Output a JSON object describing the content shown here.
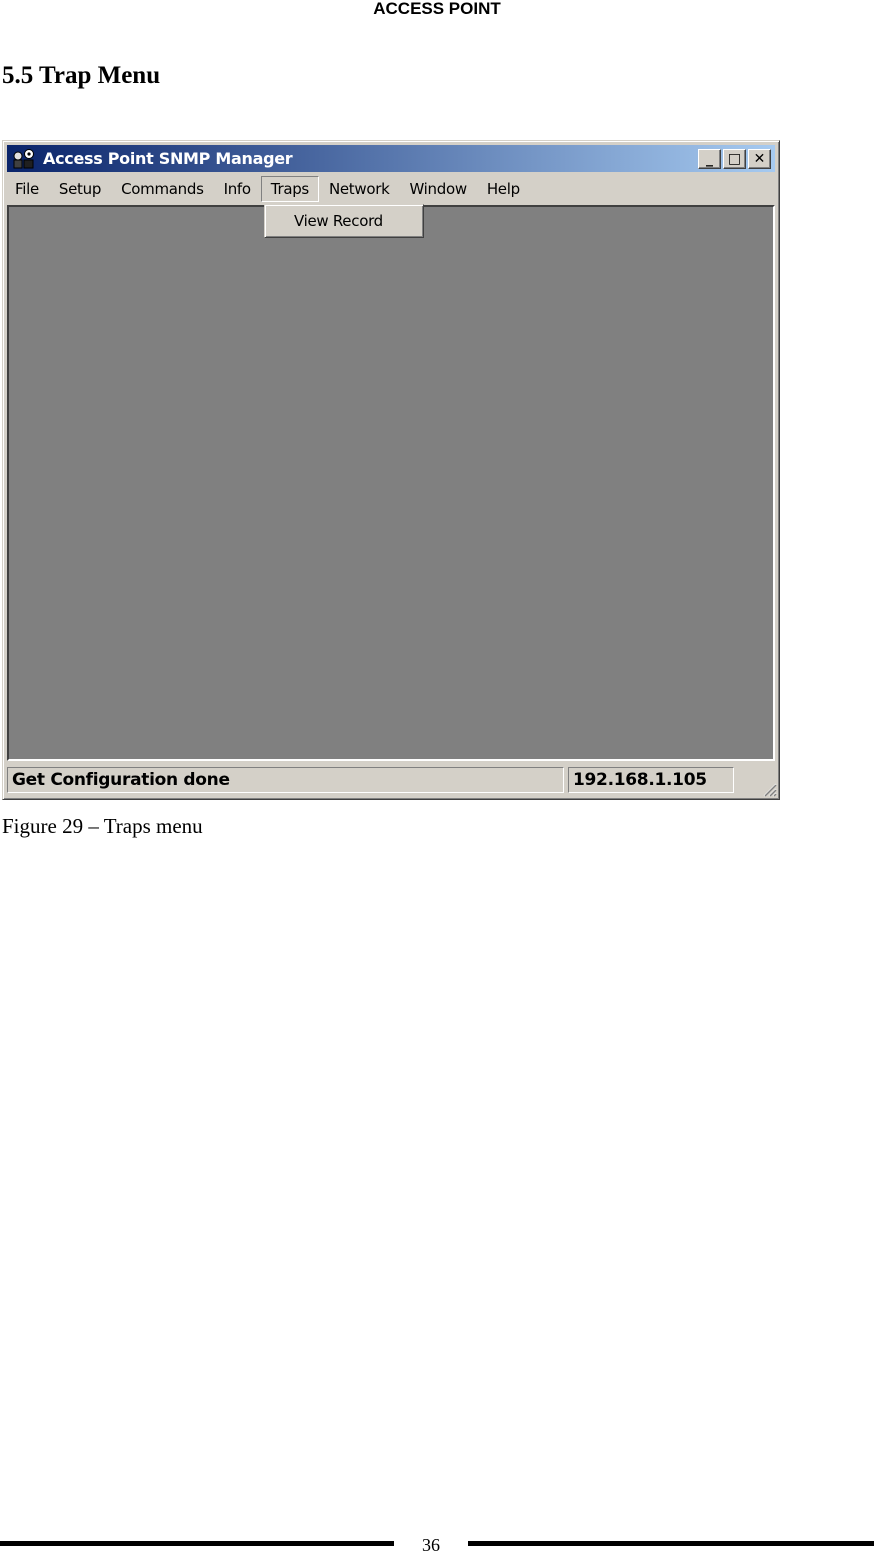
{
  "page_header": "ACCESS POINT",
  "section_title": "5.5 Trap Menu",
  "window": {
    "title": "Access Point SNMP Manager",
    "app_icon": "snmp-network-icon",
    "controls": {
      "minimize": "_",
      "maximize": "□",
      "close": "✕"
    },
    "menu": [
      {
        "label": "File"
      },
      {
        "label": "Setup"
      },
      {
        "label": "Commands"
      },
      {
        "label": "Info"
      },
      {
        "label": "Traps",
        "open": true
      },
      {
        "label": "Network"
      },
      {
        "label": "Window"
      },
      {
        "label": "Help"
      }
    ],
    "dropdown": {
      "items": [
        {
          "label": "View Record"
        }
      ]
    },
    "status": {
      "message": "Get Configuration done",
      "ip": "192.168.1.105"
    }
  },
  "caption": "Figure 29 – Traps menu",
  "page_number": "36"
}
